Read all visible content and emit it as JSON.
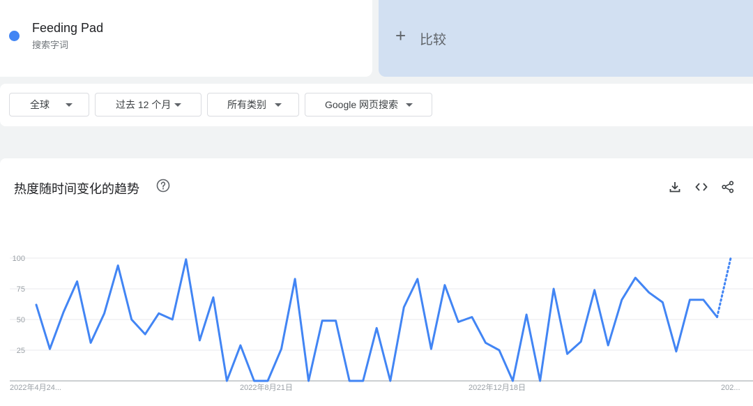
{
  "term": {
    "name": "Feeding Pad",
    "subtitle": "搜索字词",
    "color": "#4285f4"
  },
  "compare": {
    "plus_icon": "plus-icon",
    "label": "比较"
  },
  "filters": [
    {
      "label": "全球",
      "icon": "caret-down-icon"
    },
    {
      "label": "过去 12 个月",
      "icon": "caret-down-icon"
    },
    {
      "label": "所有类别",
      "icon": "caret-down-icon"
    },
    {
      "label": "Google 网页搜索",
      "icon": "caret-down-icon"
    }
  ],
  "section": {
    "title": "热度随时间变化的趋势",
    "help_icon": "help-circle-icon",
    "actions": [
      "download-icon",
      "embed-code-icon",
      "share-icon"
    ]
  },
  "chart_data": {
    "type": "line",
    "x_tick_labels": [
      "2022年4月24...",
      "2022年8月21日",
      "2022年12月18日",
      "202..."
    ],
    "y_ticks": [
      25,
      50,
      75,
      100
    ],
    "ylim": [
      0,
      100
    ],
    "grid": true,
    "series": [
      {
        "color": "#4285f4",
        "values": [
          62,
          26,
          56,
          81,
          31,
          55,
          94,
          50,
          38,
          55,
          50,
          99,
          33,
          68,
          0,
          29,
          0,
          0,
          26,
          83,
          0,
          49,
          49,
          0,
          0,
          43,
          0,
          60,
          83,
          26,
          78,
          48,
          52,
          31,
          25,
          0,
          54,
          0,
          75,
          22,
          32,
          74,
          29,
          66,
          84,
          72,
          64,
          24,
          66,
          66,
          52,
          100
        ],
        "partial_last_segment": true
      }
    ]
  }
}
